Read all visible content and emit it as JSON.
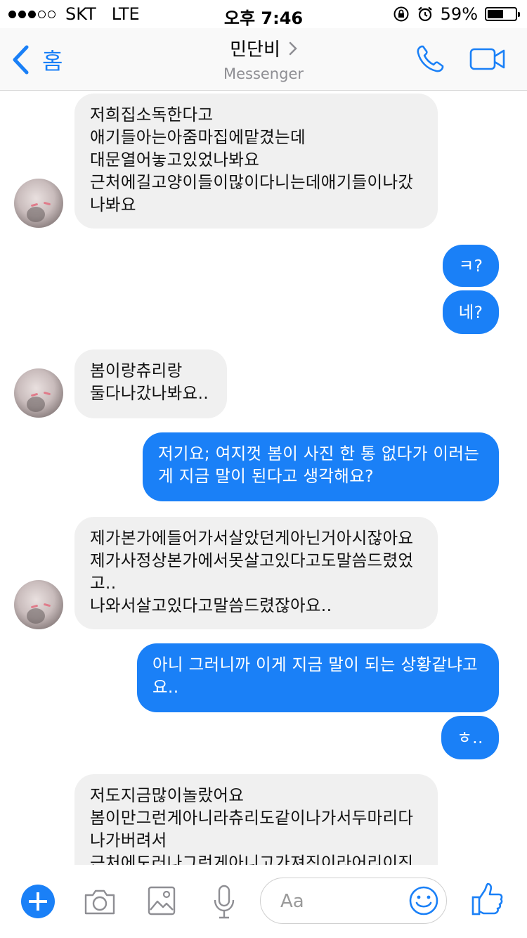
{
  "status_bar": {
    "carrier": "SKT",
    "network": "LTE",
    "time": "오후 7:46",
    "battery_percent_text": "59%",
    "battery_level": 0.59,
    "signal_bars_filled": 3,
    "signal_bars_total": 5
  },
  "nav": {
    "back_label": "홈",
    "title": "민단비",
    "subtitle": "Messenger"
  },
  "messages": [
    {
      "direction": "incoming",
      "lines": [
        "저희집소독한다고",
        "애기들아는아줌마집에맡겼는데",
        "대문열어놓고있었나봐요",
        "근처에길고양이들이많이다니는데애기들이나갔",
        "나봐요"
      ]
    },
    {
      "direction": "outgoing",
      "lines": [
        "ㅋ?"
      ]
    },
    {
      "direction": "outgoing",
      "lines": [
        "네?"
      ]
    },
    {
      "direction": "incoming",
      "lines": [
        "봄이랑츄리랑",
        "둘다나갔나봐요.."
      ]
    },
    {
      "direction": "outgoing",
      "lines": [
        "저기요; 여지껏 봄이 사진 한 통 없다가 이러는",
        "게 지금 말이 된다고 생각해요?"
      ]
    },
    {
      "direction": "incoming",
      "lines": [
        "제가본가에들어가서살았던게아닌거아시잖아요",
        "제가사정상본가에서못살고있다고도말씀드렸었",
        "고..",
        "나와서살고있다고말씀드렸잖아요.."
      ]
    },
    {
      "direction": "outgoing",
      "lines": [
        "아니 그러니까 이게 지금 말이 되는 상황같냐고",
        "요.."
      ]
    },
    {
      "direction": "outgoing",
      "lines": [
        "ㅎ.."
      ]
    },
    {
      "direction": "incoming",
      "lines": [
        "저도지금많이놀랐어요",
        "봄이만그런게아니라츄리도같이나가서두마리다",
        "나가버려서",
        "근처에도러나그런게아니고가져진이라어리이진"
      ]
    }
  ],
  "composer": {
    "placeholder": "Aa"
  },
  "colors": {
    "accent": "#1a80f7",
    "incoming_bubble": "#f0f0f0",
    "subtitle_gray": "#8e8e93"
  },
  "icons": {
    "nav": [
      "back-chevron-icon",
      "chevron-right-icon",
      "phone-icon",
      "video-camera-icon"
    ],
    "composer": [
      "plus-icon",
      "camera-icon",
      "image-icon",
      "microphone-icon",
      "emoji-icon",
      "thumbs-up-icon"
    ],
    "status": [
      "signal-dots-icon",
      "rotation-lock-icon",
      "alarm-icon",
      "battery-icon"
    ]
  }
}
